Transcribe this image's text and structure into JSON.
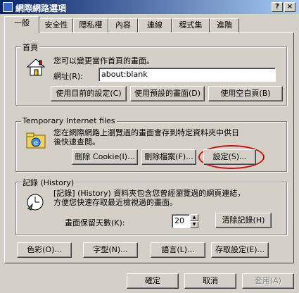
{
  "window": {
    "title": "網際網路選項",
    "help_button": "?",
    "close_button": "×"
  },
  "tabs": [
    "一般",
    "安全性",
    "隱私權",
    "內容",
    "連線",
    "程式集",
    "進階"
  ],
  "home": {
    "legend": "首頁",
    "description": "您可以變更當作首頁的畫面。",
    "address_label": "網址(R):",
    "address_value": "about:blank",
    "btn_current": "使用目前的設定(C)",
    "btn_default": "使用預設的畫面(D)",
    "btn_blank": "使用空白頁(B)"
  },
  "temp": {
    "legend": "Temporary Internet files",
    "description_1": "您在網際網路上瀏覽過的畫面會存到特定資料夾中供日",
    "description_2": "後快速查閱。",
    "btn_delete_cookies": "刪除 Cookie(I)...",
    "btn_delete_files": "刪除檔案(F)...",
    "btn_settings": "設定(S)..."
  },
  "history": {
    "legend": "記錄 (History)",
    "description_1": "[記錄] (History) 資料夾包含您曾經瀏覽過的網頁連結，",
    "description_2": "方便您快速存取最近檢視過的畫面。",
    "days_label": "畫面保留天數(K):",
    "days_value": "20",
    "btn_clear": "清除記錄(H)"
  },
  "bottom_buttons": {
    "colors": "色彩(O)...",
    "fonts": "字型(N)...",
    "languages": "語言(L)...",
    "accessibility": "存取設定(E)..."
  },
  "dialog_buttons": {
    "ok": "確定",
    "cancel": "取消",
    "apply": "套用(A)"
  },
  "colors": {
    "title_start": "#0a246a",
    "title_end": "#a6caf0",
    "face": "#d4d0c8",
    "highlight_ring": "#cc1010"
  }
}
